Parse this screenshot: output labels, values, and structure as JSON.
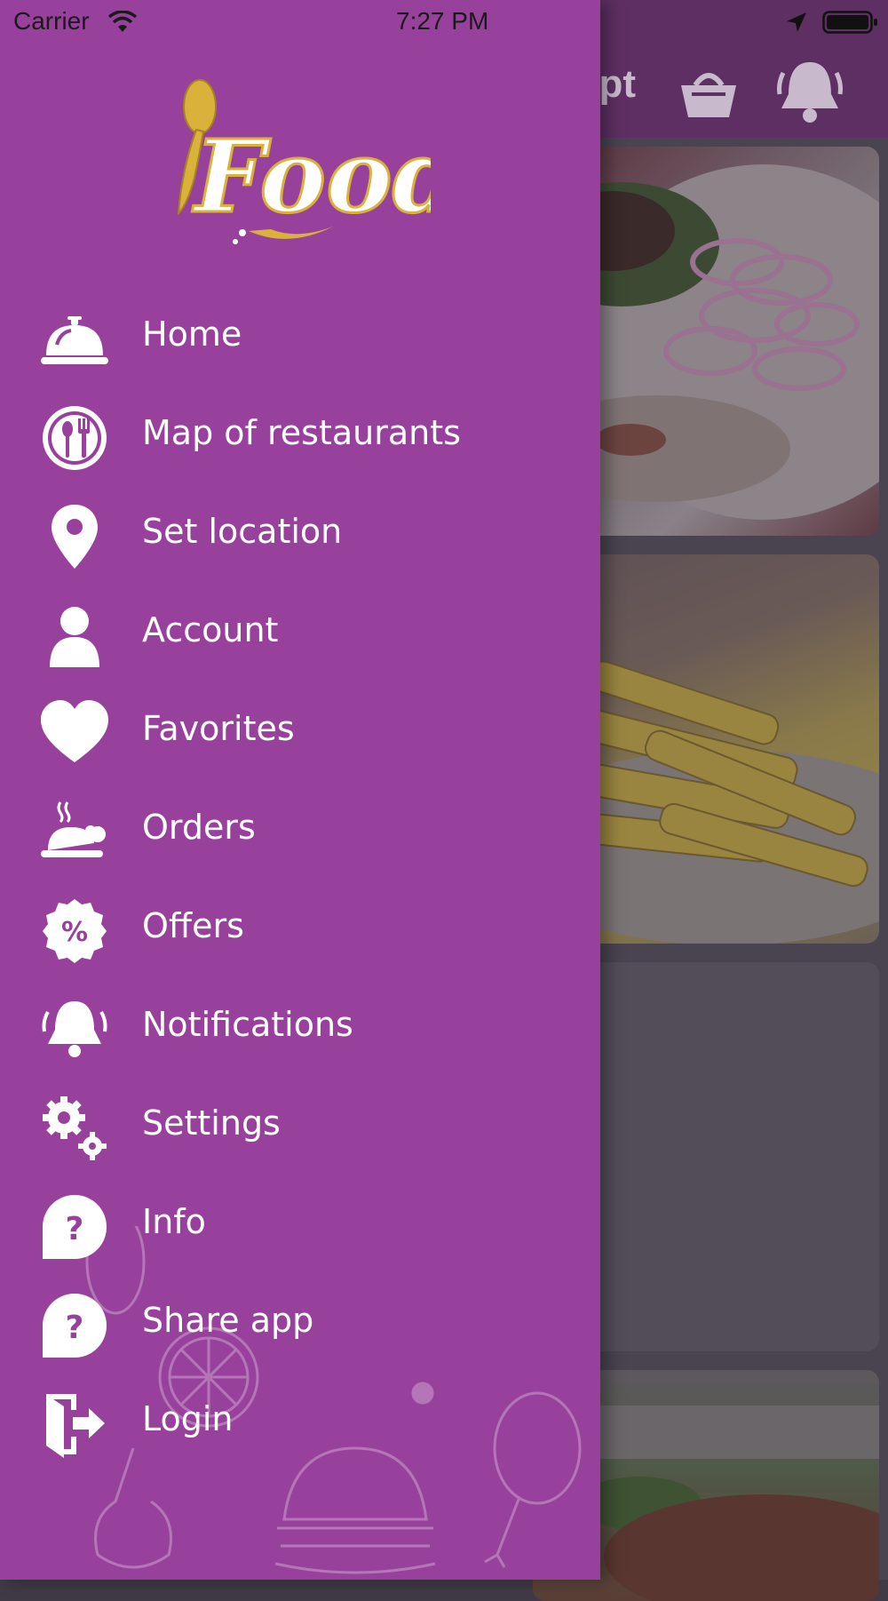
{
  "status_bar": {
    "carrier": "Carrier",
    "time": "7:27 PM",
    "icons": [
      "wifi-icon",
      "location-arrow-icon",
      "battery-icon"
    ]
  },
  "background_screen": {
    "header_text_fragment": "ypt",
    "header_icons": [
      "basket-icon",
      "bell-icon"
    ],
    "cards": [
      "food-card-salad",
      "food-card-fries",
      "food-card-empty",
      "food-card-dish"
    ]
  },
  "drawer": {
    "logo_text": "Food",
    "colors": {
      "background": "#97419c",
      "text": "#ffffff",
      "logo_gold": "#d9b13b"
    },
    "menu": [
      {
        "label": "Home",
        "icon": "cloche-icon"
      },
      {
        "label": "Map of restaurants",
        "icon": "plate-cutlery-icon"
      },
      {
        "label": "Set location",
        "icon": "map-pin-icon"
      },
      {
        "label": "Account",
        "icon": "user-icon"
      },
      {
        "label": "Favorites",
        "icon": "heart-icon"
      },
      {
        "label": "Orders",
        "icon": "hot-dish-icon"
      },
      {
        "label": "Offers",
        "icon": "percent-badge-icon"
      },
      {
        "label": "Notifications",
        "icon": "bell-icon"
      },
      {
        "label": "Settings",
        "icon": "gears-icon"
      },
      {
        "label": "Info",
        "icon": "question-bubble-icon"
      },
      {
        "label": "Share app",
        "icon": "question-bubble-icon"
      },
      {
        "label": "Login",
        "icon": "login-door-icon"
      }
    ]
  }
}
